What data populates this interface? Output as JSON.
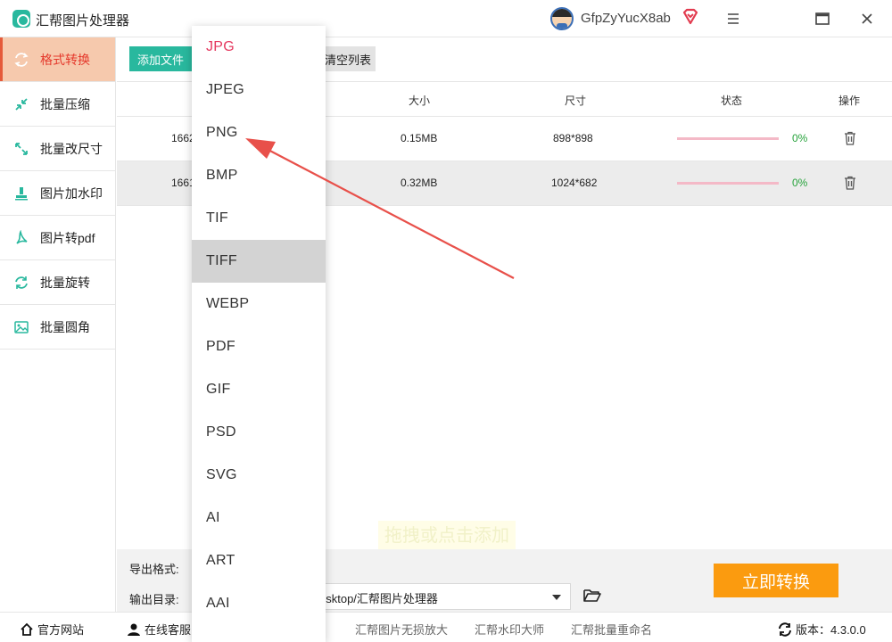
{
  "app": {
    "title": "汇帮图片处理器",
    "username": "GfpZyYucX8ab"
  },
  "colors": {
    "accent": "#29b89e",
    "active_bg": "#f6c9ad",
    "active_text": "#e5392c",
    "convert": "#fb9b0f",
    "selected_option": "#e5395f",
    "progress_pct": "#27a33c"
  },
  "sidebar": {
    "items": [
      {
        "label": "格式转换",
        "icon": "format-convert-icon"
      },
      {
        "label": "批量压缩",
        "icon": "compress-icon"
      },
      {
        "label": "批量改尺寸",
        "icon": "resize-icon"
      },
      {
        "label": "图片加水印",
        "icon": "watermark-icon"
      },
      {
        "label": "图片转pdf",
        "icon": "pdf-icon"
      },
      {
        "label": "批量旋转",
        "icon": "rotate-icon"
      },
      {
        "label": "批量圆角",
        "icon": "rounded-corner-icon"
      }
    ]
  },
  "toolbar": {
    "add_label": "添加文件",
    "clear_label": "清空列表"
  },
  "table": {
    "headers": {
      "size": "大小",
      "dimensions": "尺寸",
      "status": "状态",
      "action": "操作"
    },
    "rows": [
      {
        "name": "1662",
        "size": "0.15MB",
        "dimensions": "898*898",
        "progress": "0%",
        "progress_value": 0
      },
      {
        "name": "1661",
        "size": "0.32MB",
        "dimensions": "1024*682",
        "progress": "0%",
        "progress_value": 0
      }
    ]
  },
  "drop_hint": "拖拽或点击添加",
  "bottom": {
    "format_label": "导出格式:",
    "output_label": "输出目录:",
    "output_path": "esktop/汇帮图片处理器",
    "convert_label": "立即转换"
  },
  "footer": {
    "website": "官方网站",
    "support": "在线客服",
    "links": [
      "汇帮图片无损放大",
      "汇帮水印大师",
      "汇帮批量重命名"
    ],
    "version": "版本：4.3.0.0"
  },
  "dropdown": {
    "selected": "JPG",
    "hovered": "TIFF",
    "options": [
      "JPG",
      "JPEG",
      "PNG",
      "BMP",
      "TIF",
      "TIFF",
      "WEBP",
      "PDF",
      "GIF",
      "PSD",
      "SVG",
      "AI",
      "ART",
      "AAI"
    ]
  }
}
